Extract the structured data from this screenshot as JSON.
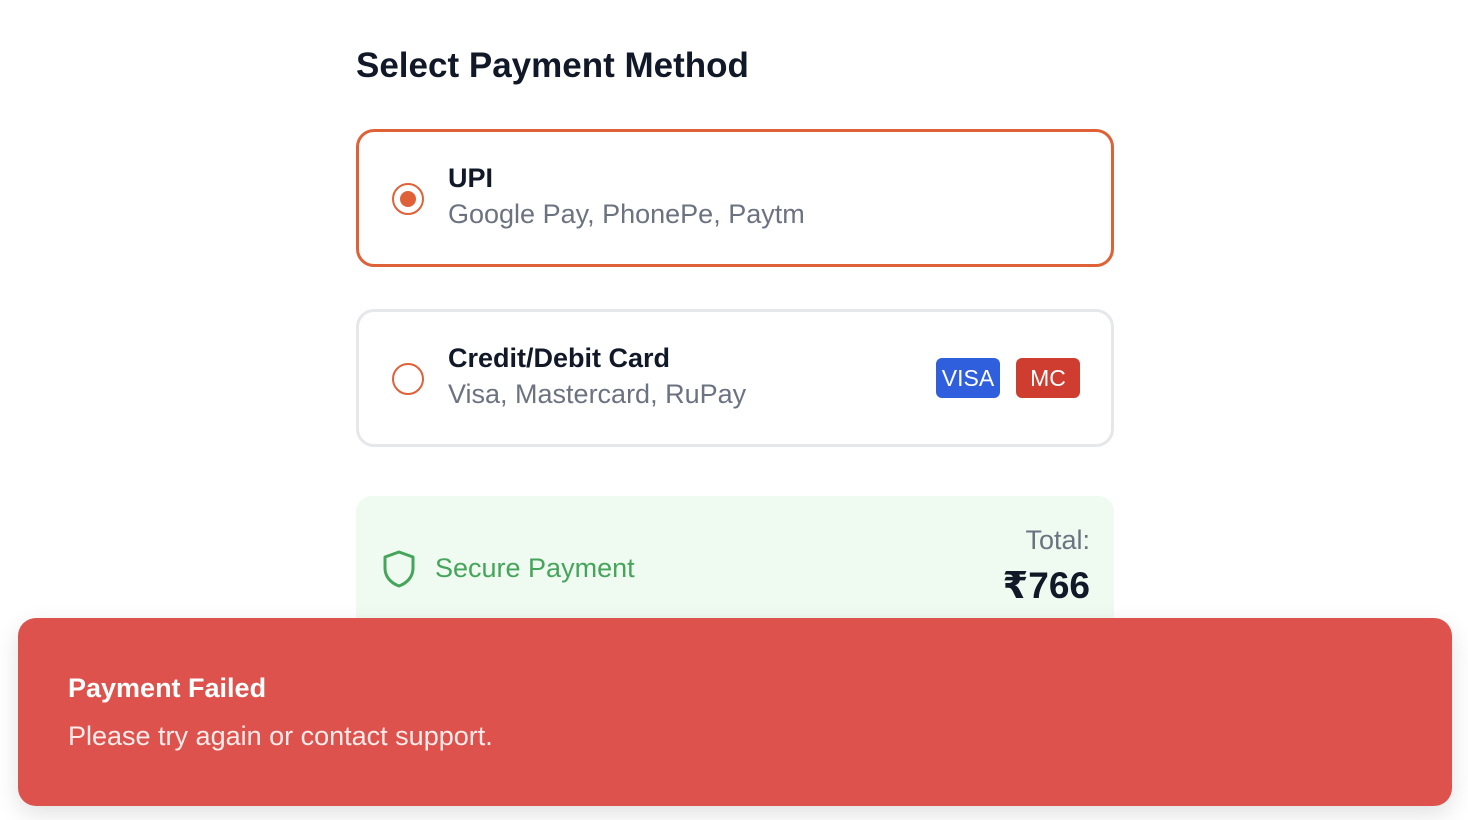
{
  "page": {
    "title": "Select Payment Method"
  },
  "payment_options": [
    {
      "title": "UPI",
      "subtitle": "Google Pay, PhonePe, Paytm",
      "selected": true
    },
    {
      "title": "Credit/Debit Card",
      "subtitle": "Visa, Mastercard, RuPay",
      "selected": false,
      "badges": [
        "VISA",
        "MC"
      ]
    }
  ],
  "summary": {
    "secure_label": "Secure Payment",
    "secure_icon": "shield-icon",
    "total_label": "Total:",
    "total_value": "₹766"
  },
  "toast": {
    "title": "Payment Failed",
    "message": "Please try again or contact support."
  },
  "colors": {
    "accent": "#df6137",
    "secure_green": "#45a55a",
    "summary_bg": "#effaf1",
    "error_bg": "#dd524c",
    "visa_badge": "#2f5fdc",
    "mastercard_badge": "#cf3c30"
  }
}
